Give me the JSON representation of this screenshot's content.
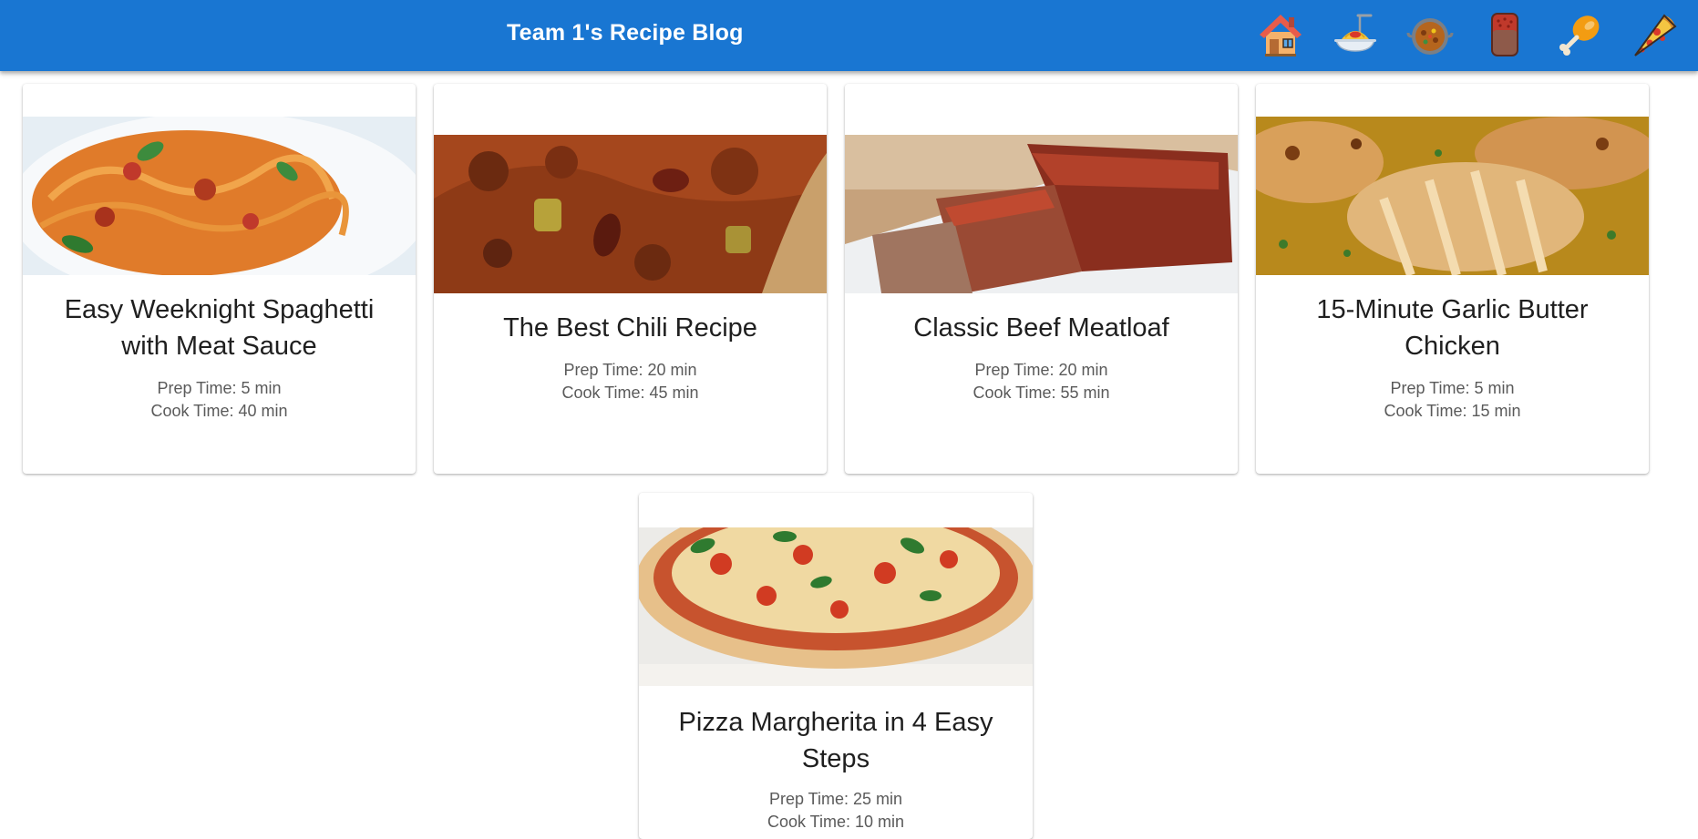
{
  "header": {
    "title": "Team 1's Recipe Blog",
    "background": "#1976d2",
    "nav_icons": [
      "house-icon",
      "spaghetti-icon",
      "stew-icon",
      "meatloaf-icon",
      "poultry-leg-icon",
      "pizza-icon"
    ]
  },
  "recipes": [
    {
      "title": "Easy Weeknight Spaghetti with Meat Sauce",
      "prep": "Prep Time: 5 min",
      "cook": "Cook Time: 40 min"
    },
    {
      "title": "The Best Chili Recipe",
      "prep": "Prep Time: 20 min",
      "cook": "Cook Time: 45 min"
    },
    {
      "title": "Classic Beef Meatloaf",
      "prep": "Prep Time: 20 min",
      "cook": "Cook Time: 55 min"
    },
    {
      "title": "15-Minute Garlic Butter Chicken",
      "prep": "Prep Time: 5 min",
      "cook": "Cook Time: 15 min"
    },
    {
      "title": "Pizza Margherita in 4 Easy Steps",
      "prep": "Prep Time: 25 min",
      "cook": "Cook Time: 10 min"
    }
  ]
}
